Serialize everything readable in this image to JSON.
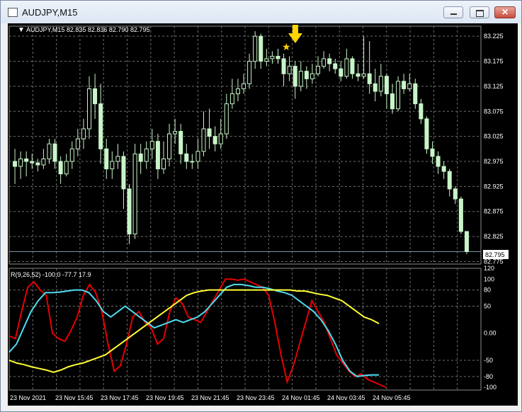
{
  "window": {
    "title": "AUDJPY,M15",
    "icon": "chart-window-icon",
    "buttons": {
      "minimize": "minimize-icon",
      "maximize": "maximize-icon",
      "close": "close-icon",
      "close_glyph": "✕"
    }
  },
  "colors": {
    "background": "#000000",
    "grid": "#6e6e6e",
    "candle": "#c8f5c8",
    "arrow": "#ffd400",
    "red_line": "#e60000",
    "cyan_line": "#4fdcf0",
    "yellow_line": "#ffff33",
    "text": "#ffffff"
  },
  "main_panel": {
    "header": "AUDJPY,M15  82.835 82.836 82.790 82.795",
    "price_label": "82.795",
    "signal_marks": [
      {
        "icon": "star-icon",
        "glyph": "★"
      },
      {
        "icon": "arrow-down-icon"
      }
    ]
  },
  "indicator_panel": {
    "header": "R(9,26,52) -100.0 -77.7 17.9"
  },
  "chart_data": [
    {
      "type": "candlestick",
      "title": "AUDJPY,M15",
      "ohlc_header": {
        "open": 82.835,
        "high": 82.836,
        "low": 82.79,
        "close": 82.795
      },
      "y_ticks": [
        "83.225",
        "83.175",
        "83.125",
        "83.075",
        "83.025",
        "82.975",
        "82.925",
        "82.875",
        "82.825",
        "82.775"
      ],
      "ylim": [
        82.77,
        83.245
      ],
      "x_ticks": [
        "23 Nov 2021",
        "23 Nov 15:45",
        "23 Nov 17:45",
        "23 Nov 19:45",
        "23 Nov 21:45",
        "23 Nov 23:45",
        "24 Nov 01:45",
        "24 Nov 03:45",
        "24 Nov 05:45"
      ],
      "current_price": 82.795,
      "candles": [
        [
          82.975,
          82.965,
          83.0,
          82.93
        ],
        [
          82.965,
          82.98,
          82.995,
          82.94
        ],
        [
          82.98,
          82.975,
          82.995,
          82.945
        ],
        [
          82.975,
          82.972,
          82.99,
          82.96
        ],
        [
          82.972,
          82.968,
          82.98,
          82.955
        ],
        [
          82.968,
          82.98,
          83.0,
          82.96
        ],
        [
          82.98,
          83.01,
          83.02,
          82.97
        ],
        [
          83.01,
          82.975,
          83.02,
          82.96
        ],
        [
          82.975,
          82.95,
          82.985,
          82.93
        ],
        [
          82.95,
          82.975,
          82.99,
          82.945
        ],
        [
          82.975,
          83.0,
          83.015,
          82.96
        ],
        [
          83.0,
          83.02,
          83.04,
          82.985
        ],
        [
          83.02,
          83.04,
          83.06,
          83.0
        ],
        [
          83.04,
          83.12,
          83.145,
          83.02
        ],
        [
          83.12,
          83.09,
          83.15,
          83.06
        ],
        [
          83.09,
          83.0,
          83.13,
          82.97
        ],
        [
          83.0,
          82.96,
          83.02,
          82.94
        ],
        [
          82.96,
          82.975,
          82.995,
          82.94
        ],
        [
          82.975,
          82.985,
          83.01,
          82.96
        ],
        [
          82.985,
          82.92,
          82.995,
          82.88
        ],
        [
          82.92,
          82.83,
          82.93,
          82.81
        ],
        [
          82.83,
          82.99,
          83.01,
          82.82
        ],
        [
          82.99,
          82.975,
          83.01,
          82.95
        ],
        [
          82.975,
          83.0,
          83.015,
          82.96
        ],
        [
          83.0,
          83.015,
          83.04,
          82.98
        ],
        [
          83.015,
          82.96,
          83.03,
          82.94
        ],
        [
          82.96,
          82.98,
          83.015,
          82.95
        ],
        [
          82.98,
          83.03,
          83.05,
          82.965
        ],
        [
          83.03,
          83.035,
          83.06,
          83.01
        ],
        [
          83.035,
          82.99,
          83.05,
          82.97
        ],
        [
          82.99,
          82.975,
          83.01,
          82.96
        ],
        [
          82.975,
          82.975,
          82.99,
          82.96
        ],
        [
          82.975,
          82.995,
          83.02,
          82.96
        ],
        [
          82.995,
          83.04,
          83.075,
          82.985
        ],
        [
          83.04,
          83.025,
          83.08,
          83.0
        ],
        [
          83.025,
          83.01,
          83.045,
          82.995
        ],
        [
          83.01,
          83.03,
          83.06,
          83.0
        ],
        [
          83.03,
          83.09,
          83.11,
          83.02
        ],
        [
          83.09,
          83.11,
          83.14,
          83.08
        ],
        [
          83.11,
          83.12,
          83.14,
          83.095
        ],
        [
          83.12,
          83.13,
          83.15,
          83.11
        ],
        [
          83.13,
          83.175,
          83.19,
          83.12
        ],
        [
          83.175,
          83.225,
          83.235,
          83.16
        ],
        [
          83.225,
          83.175,
          83.23,
          83.16
        ],
        [
          83.175,
          83.18,
          83.2,
          83.165
        ],
        [
          83.18,
          83.185,
          83.195,
          83.17
        ],
        [
          83.185,
          83.18,
          83.2,
          83.17
        ],
        [
          83.18,
          83.15,
          83.19,
          83.125
        ],
        [
          83.15,
          83.165,
          83.185,
          83.135
        ],
        [
          83.165,
          83.125,
          83.175,
          83.1
        ],
        [
          83.125,
          83.155,
          83.175,
          83.115
        ],
        [
          83.155,
          83.14,
          83.165,
          83.12
        ],
        [
          83.14,
          83.15,
          83.17,
          83.13
        ],
        [
          83.15,
          83.165,
          83.185,
          83.145
        ],
        [
          83.165,
          83.18,
          83.195,
          83.16
        ],
        [
          83.18,
          83.17,
          83.19,
          83.155
        ],
        [
          83.17,
          83.16,
          83.18,
          83.15
        ],
        [
          83.16,
          83.145,
          83.175,
          83.135
        ],
        [
          83.145,
          83.18,
          83.2,
          83.14
        ],
        [
          83.18,
          83.15,
          83.185,
          83.14
        ],
        [
          83.15,
          83.145,
          83.17,
          83.135
        ],
        [
          83.145,
          83.15,
          83.225,
          83.14
        ],
        [
          83.15,
          83.13,
          83.215,
          83.11
        ],
        [
          83.13,
          83.115,
          83.16,
          83.095
        ],
        [
          83.115,
          83.145,
          83.17,
          83.105
        ],
        [
          83.145,
          83.11,
          83.15,
          83.08
        ],
        [
          83.11,
          83.08,
          83.13,
          83.07
        ],
        [
          83.08,
          83.135,
          83.145,
          83.075
        ],
        [
          83.135,
          83.12,
          83.15,
          83.11
        ],
        [
          83.12,
          83.13,
          83.15,
          83.115
        ],
        [
          83.13,
          83.09,
          83.14,
          83.08
        ],
        [
          83.09,
          83.06,
          83.1,
          83.05
        ],
        [
          83.06,
          83.0,
          83.065,
          82.99
        ],
        [
          83.0,
          82.985,
          83.015,
          82.97
        ],
        [
          82.985,
          82.965,
          82.995,
          82.95
        ],
        [
          82.965,
          82.955,
          82.975,
          82.94
        ],
        [
          82.955,
          82.92,
          82.96,
          82.905
        ],
        [
          82.92,
          82.9,
          82.925,
          82.89
        ],
        [
          82.9,
          82.835,
          82.905,
          82.83
        ],
        [
          82.835,
          82.795,
          82.836,
          82.79
        ]
      ]
    },
    {
      "type": "line",
      "title": "R(9,26,52) -100.0 -77.7 17.9",
      "y_ticks": [
        "120",
        "100",
        "80",
        "50",
        "0.00",
        "-50",
        "-80",
        "-100"
      ],
      "ylim": [
        -105,
        120
      ],
      "series": [
        {
          "color": "#e60000",
          "values": [
            -5,
            -10,
            40,
            85,
            95,
            80,
            70,
            0,
            -10,
            -15,
            5,
            30,
            70,
            90,
            75,
            40,
            -20,
            -70,
            -60,
            -20,
            30,
            40,
            20,
            10,
            -20,
            -10,
            40,
            65,
            55,
            30,
            25,
            20,
            40,
            60,
            80,
            100,
            100,
            98,
            100,
            95,
            90,
            85,
            70,
            20,
            -40,
            -90,
            -60,
            -20,
            20,
            60,
            40,
            20,
            -10,
            -40,
            -55,
            -70,
            -80,
            -75,
            -85,
            -90,
            -95,
            -100
          ]
        },
        {
          "color": "#4fdcf0",
          "values": [
            -35,
            -20,
            10,
            40,
            60,
            75,
            75,
            76,
            78,
            80,
            80,
            75,
            60,
            40,
            30,
            40,
            50,
            40,
            30,
            20,
            10,
            15,
            20,
            25,
            20,
            25,
            30,
            40,
            55,
            70,
            85,
            90,
            90,
            88,
            85,
            85,
            82,
            78,
            75,
            70,
            60,
            50,
            40,
            25,
            5,
            -20,
            -50,
            -70,
            -80,
            -78,
            -77,
            -77
          ]
        },
        {
          "color": "#ffff33",
          "values": [
            -50,
            -55,
            -58,
            -62,
            -65,
            -68,
            -72,
            -68,
            -62,
            -58,
            -55,
            -50,
            -45,
            -40,
            -30,
            -20,
            -10,
            0,
            10,
            20,
            30,
            40,
            50,
            60,
            70,
            75,
            78,
            80,
            80,
            80,
            80,
            80,
            80,
            80,
            80,
            80,
            80,
            80,
            80,
            78,
            78,
            75,
            72,
            70,
            65,
            60,
            50,
            40,
            30,
            25,
            18
          ]
        }
      ]
    }
  ]
}
